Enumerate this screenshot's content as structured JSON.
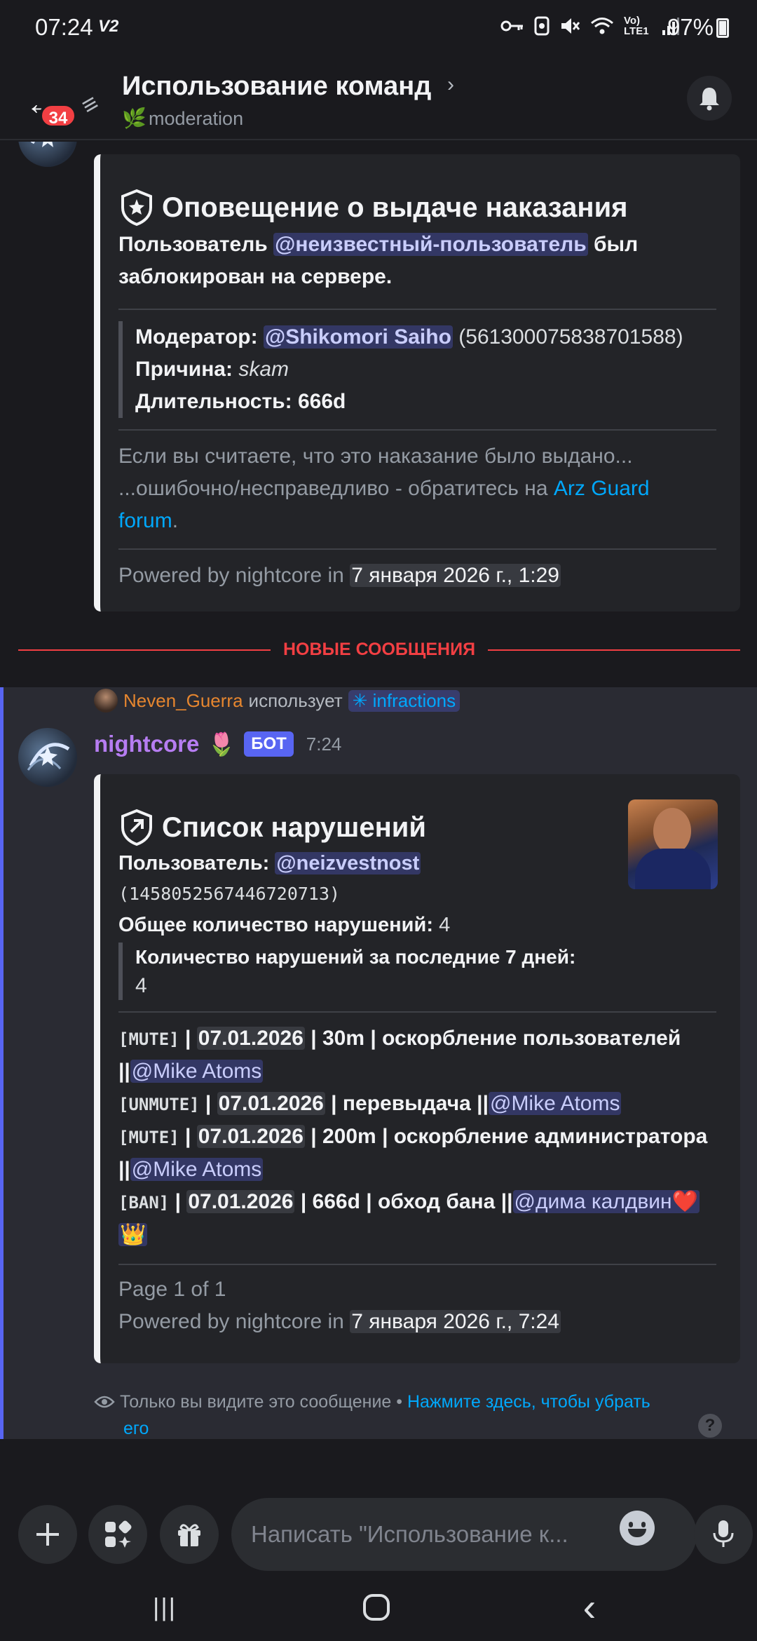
{
  "status_bar": {
    "time": "07:24",
    "carrier_mark": "V2",
    "network_label": "Vo) LTE1",
    "battery": "97%",
    "icons": [
      "key-icon",
      "notification-icon",
      "mute-icon",
      "wifi-icon",
      "signal-icon",
      "battery-icon"
    ]
  },
  "header": {
    "title": "Использование команд",
    "subtitle": "moderation",
    "subtitle_icon": "🌿",
    "unread_count": "34",
    "chevron": "›"
  },
  "embed1": {
    "title": "Оповещение о выдаче наказания",
    "desc_pre": "Пользователь ",
    "desc_mention": "@неизвестный-пользователь",
    "desc_post1": " был",
    "desc_post2": "заблокирован на сервере.",
    "moderator_label": "Модератор:",
    "moderator_mention": "@Shikomori Saiho",
    "moderator_id": "(561300075838701588)",
    "reason_label": "Причина:",
    "reason_value": "skam",
    "duration_label": "Длительность:",
    "duration_value": "666d",
    "appeal_line1": "Если вы считаете, что это наказание было выдано...",
    "appeal_line2_pre": "...ошибочно/несправедливо - обратитесь на ",
    "appeal_link1": "Arz Guard",
    "appeal_link2": "forum",
    "appeal_dot": ".",
    "footer_pre": "Powered by nightcore in ",
    "footer_ts": "7 января 2026 г., 1:29"
  },
  "new_messages_label": "НОВЫЕ СООБЩЕНИЯ",
  "command_usage": {
    "user": "Neven_Guerra",
    "verb": "использует",
    "command": "infractions",
    "command_icon": "✳"
  },
  "message2": {
    "author": "nightcore",
    "author_emoji": "🌷",
    "bot_tag": "БОТ",
    "time": "7:24"
  },
  "embed2": {
    "title": "Список нарушений",
    "user_label": "Пользователь:",
    "user_mention": "@neizvestnost",
    "user_id": "(1458052567446720713)",
    "total_label": "Общее количество нарушений:",
    "total_value": "4",
    "recent_label": "Количество нарушений за последние 7 дней:",
    "recent_value": "4",
    "infractions": [
      {
        "type": "[MUTE]",
        "date": "07.01.2026",
        "rest": " | 30m | оскорбление пользователей",
        "cont": "||",
        "mention": "@Mike Atoms"
      },
      {
        "type": "[UNMUTE]",
        "date": "07.01.2026",
        "rest": " | перевыдача ||",
        "mention": "@Mike Atoms"
      },
      {
        "type": "[MUTE]",
        "date": "07.01.2026",
        "rest": " | 200m | оскорбление администратора",
        "cont": "||",
        "mention": "@Mike Atoms"
      },
      {
        "type": "[BAN]",
        "date": "07.01.2026",
        "rest": " | 666d | обход бана ||",
        "mention": "@дима калдвин❤️",
        "extra": "👑"
      }
    ],
    "page_info": "Page 1 of 1",
    "footer_pre": "Powered by nightcore in ",
    "footer_ts": "7 января 2026 г., 7:24"
  },
  "ephemeral": {
    "text": "Только вы видите это сообщение • ",
    "link_line1": "Нажмите здесь, чтобы убрать",
    "link_line2": "его",
    "help": "?"
  },
  "composer": {
    "placeholder": "Написать \"Использование к...",
    "icons": [
      "plus-icon",
      "apps-icon",
      "gift-icon",
      "emoji-icon",
      "microphone-icon"
    ]
  },
  "nav": {
    "recents": "|||",
    "home": "◯",
    "back": "‹"
  },
  "colors": {
    "background": "#1a1a1e",
    "embed_bg": "#232428",
    "accent": "#5865f2",
    "mention_text": "#c9cdfb",
    "link": "#00a8fc",
    "new_divider": "#f23f43",
    "author_name": "#b67df2",
    "username": "#e6862f"
  }
}
